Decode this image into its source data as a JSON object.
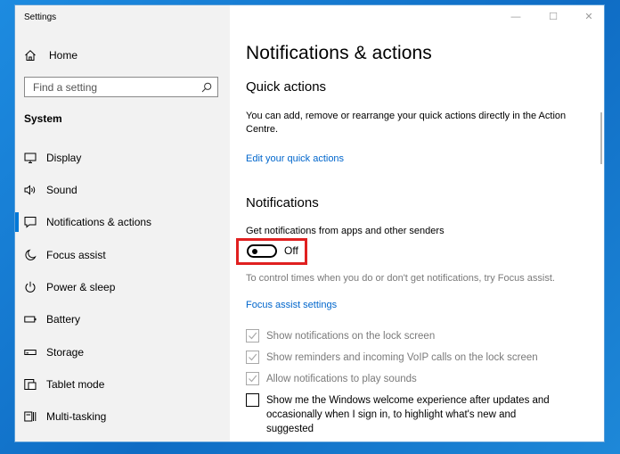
{
  "window": {
    "app_title": "Settings",
    "controls": {
      "minimize": "—",
      "maximize": "☐",
      "close": "✕"
    }
  },
  "sidebar": {
    "home_label": "Home",
    "search_placeholder": "Find a setting",
    "section_heading": "System",
    "items": [
      {
        "label": "Display",
        "icon": "display-icon",
        "active": false
      },
      {
        "label": "Sound",
        "icon": "sound-icon",
        "active": false
      },
      {
        "label": "Notifications & actions",
        "icon": "notifications-icon",
        "active": true
      },
      {
        "label": "Focus assist",
        "icon": "focus-assist-icon",
        "active": false
      },
      {
        "label": "Power & sleep",
        "icon": "power-icon",
        "active": false
      },
      {
        "label": "Battery",
        "icon": "battery-icon",
        "active": false
      },
      {
        "label": "Storage",
        "icon": "storage-icon",
        "active": false
      },
      {
        "label": "Tablet mode",
        "icon": "tablet-mode-icon",
        "active": false
      },
      {
        "label": "Multi-tasking",
        "icon": "multitasking-icon",
        "active": false
      }
    ]
  },
  "main": {
    "page_title": "Notifications & actions",
    "quick_actions": {
      "heading": "Quick actions",
      "description": "You can add, remove or rearrange your quick actions directly in the Action Centre.",
      "edit_link": "Edit your quick actions"
    },
    "notifications": {
      "heading": "Notifications",
      "get_notifications_label": "Get notifications from apps and other senders",
      "toggle_state": "Off",
      "focus_hint": "To control times when you do or don't get notifications, try Focus assist.",
      "focus_link": "Focus assist settings",
      "checkboxes": [
        {
          "label": "Show notifications on the lock screen",
          "checked": true,
          "disabled": true
        },
        {
          "label": "Show reminders and incoming VoIP calls on the lock screen",
          "checked": true,
          "disabled": true
        },
        {
          "label": "Allow notifications to play sounds",
          "checked": true,
          "disabled": true
        },
        {
          "label": "Show me the Windows welcome experience after updates and occasionally when I sign in, to highlight what's new and suggested",
          "checked": false,
          "disabled": false
        }
      ]
    }
  },
  "colors": {
    "accent": "#0078d7",
    "link": "#0066cc",
    "highlight": "#e02020",
    "sidebar_bg": "#f2f2f2"
  }
}
